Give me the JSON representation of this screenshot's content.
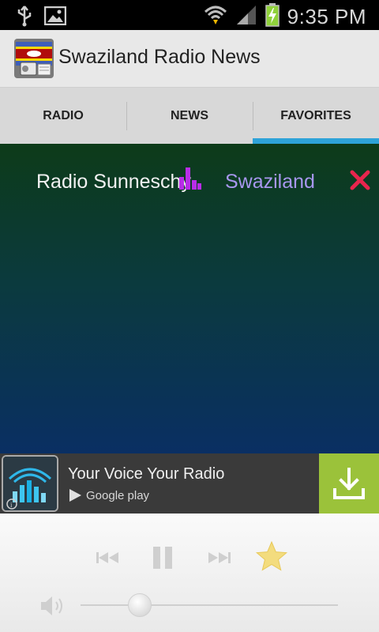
{
  "status_bar": {
    "time": "9:35 PM",
    "icons": [
      "usb-icon",
      "image-icon",
      "wifi-icon",
      "signal-icon",
      "battery-charging-icon"
    ]
  },
  "app_bar": {
    "title": "Swaziland Radio News",
    "icon": "swaziland-flag-radio-icon"
  },
  "tabs": [
    {
      "label": "RADIO",
      "active": false
    },
    {
      "label": "NEWS",
      "active": false
    },
    {
      "label": "FAVORITES",
      "active": true
    }
  ],
  "favorites": [
    {
      "station": "Radio Sunneschy",
      "country": "Swaziland",
      "playing_icon": "equalizer-icon",
      "remove_icon": "close-icon"
    }
  ],
  "ad": {
    "title": "Your Voice Your Radio",
    "store_label": "Google play",
    "icon": "radio-equalizer-app-icon",
    "info_icon": "info-icon",
    "action_icon": "download-icon"
  },
  "player": {
    "controls": [
      "previous-icon",
      "pause-icon",
      "next-icon",
      "favorite-star-icon"
    ],
    "volume_level": 0.23
  },
  "colors": {
    "tab_indicator": "#2ea3d8",
    "country_text": "#a797ee",
    "delete": "#e8254d",
    "equalizer": "#b82de8",
    "download_bg": "#9bc23a"
  }
}
